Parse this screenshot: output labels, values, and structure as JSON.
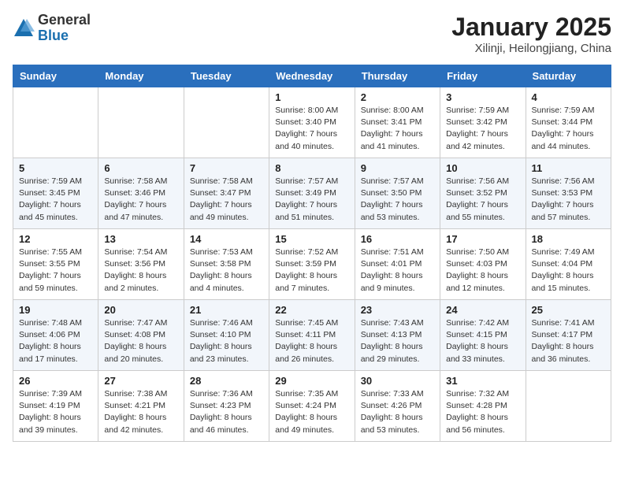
{
  "header": {
    "logo_line1": "General",
    "logo_line2": "Blue",
    "month_title": "January 2025",
    "subtitle": "Xilinji, Heilongjiang, China"
  },
  "days_of_week": [
    "Sunday",
    "Monday",
    "Tuesday",
    "Wednesday",
    "Thursday",
    "Friday",
    "Saturday"
  ],
  "weeks": [
    [
      {
        "day": "",
        "info": ""
      },
      {
        "day": "",
        "info": ""
      },
      {
        "day": "",
        "info": ""
      },
      {
        "day": "1",
        "info": "Sunrise: 8:00 AM\nSunset: 3:40 PM\nDaylight: 7 hours\nand 40 minutes."
      },
      {
        "day": "2",
        "info": "Sunrise: 8:00 AM\nSunset: 3:41 PM\nDaylight: 7 hours\nand 41 minutes."
      },
      {
        "day": "3",
        "info": "Sunrise: 7:59 AM\nSunset: 3:42 PM\nDaylight: 7 hours\nand 42 minutes."
      },
      {
        "day": "4",
        "info": "Sunrise: 7:59 AM\nSunset: 3:44 PM\nDaylight: 7 hours\nand 44 minutes."
      }
    ],
    [
      {
        "day": "5",
        "info": "Sunrise: 7:59 AM\nSunset: 3:45 PM\nDaylight: 7 hours\nand 45 minutes."
      },
      {
        "day": "6",
        "info": "Sunrise: 7:58 AM\nSunset: 3:46 PM\nDaylight: 7 hours\nand 47 minutes."
      },
      {
        "day": "7",
        "info": "Sunrise: 7:58 AM\nSunset: 3:47 PM\nDaylight: 7 hours\nand 49 minutes."
      },
      {
        "day": "8",
        "info": "Sunrise: 7:57 AM\nSunset: 3:49 PM\nDaylight: 7 hours\nand 51 minutes."
      },
      {
        "day": "9",
        "info": "Sunrise: 7:57 AM\nSunset: 3:50 PM\nDaylight: 7 hours\nand 53 minutes."
      },
      {
        "day": "10",
        "info": "Sunrise: 7:56 AM\nSunset: 3:52 PM\nDaylight: 7 hours\nand 55 minutes."
      },
      {
        "day": "11",
        "info": "Sunrise: 7:56 AM\nSunset: 3:53 PM\nDaylight: 7 hours\nand 57 minutes."
      }
    ],
    [
      {
        "day": "12",
        "info": "Sunrise: 7:55 AM\nSunset: 3:55 PM\nDaylight: 7 hours\nand 59 minutes."
      },
      {
        "day": "13",
        "info": "Sunrise: 7:54 AM\nSunset: 3:56 PM\nDaylight: 8 hours\nand 2 minutes."
      },
      {
        "day": "14",
        "info": "Sunrise: 7:53 AM\nSunset: 3:58 PM\nDaylight: 8 hours\nand 4 minutes."
      },
      {
        "day": "15",
        "info": "Sunrise: 7:52 AM\nSunset: 3:59 PM\nDaylight: 8 hours\nand 7 minutes."
      },
      {
        "day": "16",
        "info": "Sunrise: 7:51 AM\nSunset: 4:01 PM\nDaylight: 8 hours\nand 9 minutes."
      },
      {
        "day": "17",
        "info": "Sunrise: 7:50 AM\nSunset: 4:03 PM\nDaylight: 8 hours\nand 12 minutes."
      },
      {
        "day": "18",
        "info": "Sunrise: 7:49 AM\nSunset: 4:04 PM\nDaylight: 8 hours\nand 15 minutes."
      }
    ],
    [
      {
        "day": "19",
        "info": "Sunrise: 7:48 AM\nSunset: 4:06 PM\nDaylight: 8 hours\nand 17 minutes."
      },
      {
        "day": "20",
        "info": "Sunrise: 7:47 AM\nSunset: 4:08 PM\nDaylight: 8 hours\nand 20 minutes."
      },
      {
        "day": "21",
        "info": "Sunrise: 7:46 AM\nSunset: 4:10 PM\nDaylight: 8 hours\nand 23 minutes."
      },
      {
        "day": "22",
        "info": "Sunrise: 7:45 AM\nSunset: 4:11 PM\nDaylight: 8 hours\nand 26 minutes."
      },
      {
        "day": "23",
        "info": "Sunrise: 7:43 AM\nSunset: 4:13 PM\nDaylight: 8 hours\nand 29 minutes."
      },
      {
        "day": "24",
        "info": "Sunrise: 7:42 AM\nSunset: 4:15 PM\nDaylight: 8 hours\nand 33 minutes."
      },
      {
        "day": "25",
        "info": "Sunrise: 7:41 AM\nSunset: 4:17 PM\nDaylight: 8 hours\nand 36 minutes."
      }
    ],
    [
      {
        "day": "26",
        "info": "Sunrise: 7:39 AM\nSunset: 4:19 PM\nDaylight: 8 hours\nand 39 minutes."
      },
      {
        "day": "27",
        "info": "Sunrise: 7:38 AM\nSunset: 4:21 PM\nDaylight: 8 hours\nand 42 minutes."
      },
      {
        "day": "28",
        "info": "Sunrise: 7:36 AM\nSunset: 4:23 PM\nDaylight: 8 hours\nand 46 minutes."
      },
      {
        "day": "29",
        "info": "Sunrise: 7:35 AM\nSunset: 4:24 PM\nDaylight: 8 hours\nand 49 minutes."
      },
      {
        "day": "30",
        "info": "Sunrise: 7:33 AM\nSunset: 4:26 PM\nDaylight: 8 hours\nand 53 minutes."
      },
      {
        "day": "31",
        "info": "Sunrise: 7:32 AM\nSunset: 4:28 PM\nDaylight: 8 hours\nand 56 minutes."
      },
      {
        "day": "",
        "info": ""
      }
    ]
  ]
}
